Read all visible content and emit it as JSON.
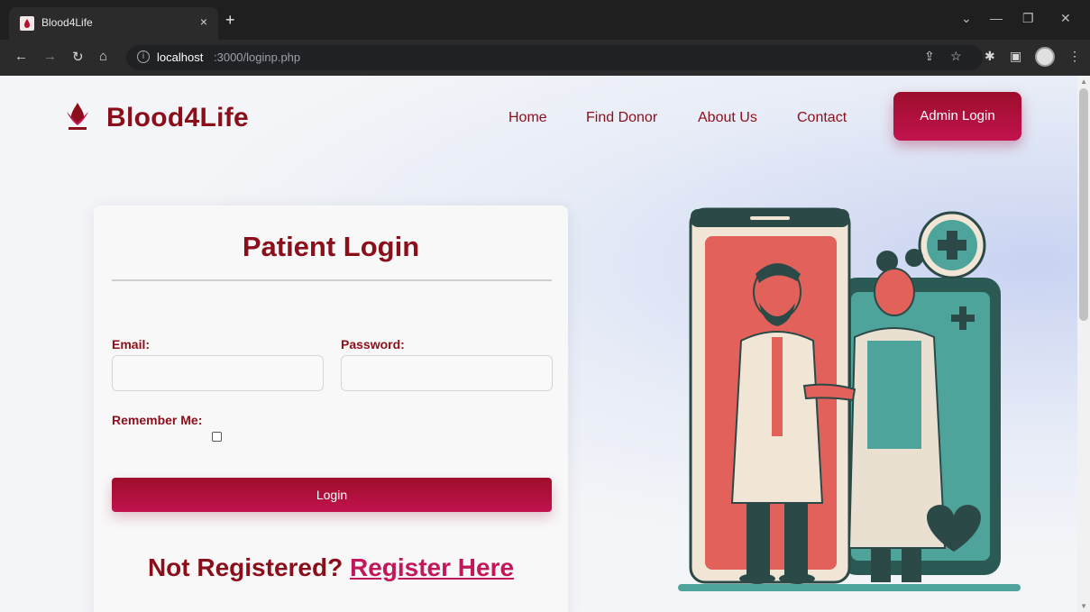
{
  "browser": {
    "tab_title": "Blood4Life",
    "tab_close": "×",
    "new_tab": "+",
    "url_host": "localhost",
    "url_path": ":3000/loginp.php",
    "info_glyph": "i"
  },
  "header": {
    "brand": "Blood4Life",
    "nav": [
      "Home",
      "Find Donor",
      "About Us",
      "Contact"
    ],
    "admin_login": "Admin Login"
  },
  "login_form": {
    "title": "Patient Login",
    "email_label": "Email:",
    "email_value": "",
    "password_label": "Password:",
    "password_value": "",
    "remember_label": "Remember Me:",
    "remember_checked": false,
    "submit_label": "Login",
    "not_registered": "Not Registered?",
    "register_link": "Register Here"
  },
  "colors": {
    "brand": "#8b0f1a",
    "accent": "#c2124f",
    "link": "#c2185b"
  }
}
